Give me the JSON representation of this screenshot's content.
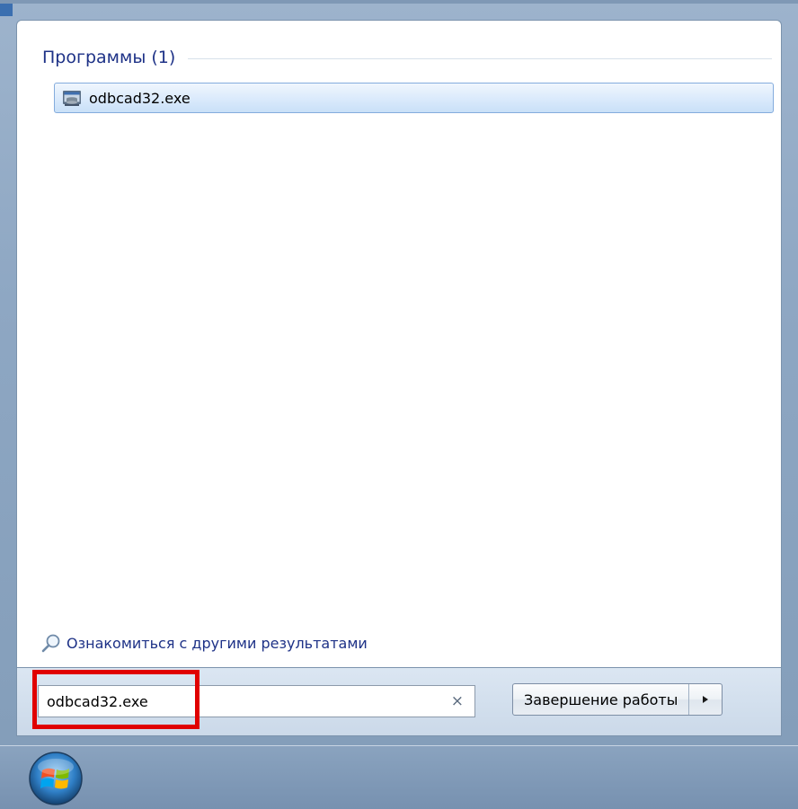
{
  "programs_group": {
    "title": "Программы (1)",
    "results": [
      {
        "label": "odbcad32.exe",
        "icon": "odbc-admin-icon"
      }
    ]
  },
  "more_results": {
    "label": "Ознакомиться с другими результатами",
    "icon": "search-magnifier-icon"
  },
  "search": {
    "value": "odbcad32.exe",
    "clear_symbol": "×"
  },
  "shutdown": {
    "label": "Завершение работы",
    "arrow_icon": "triangle-right-icon"
  },
  "taskbar": {
    "start_icon": "windows-start-orb-icon"
  },
  "colors": {
    "highlight_border": "#e00000",
    "group_title": "#1e3287",
    "link_text": "#1e3287",
    "selected_item_border": "#84acdd"
  }
}
